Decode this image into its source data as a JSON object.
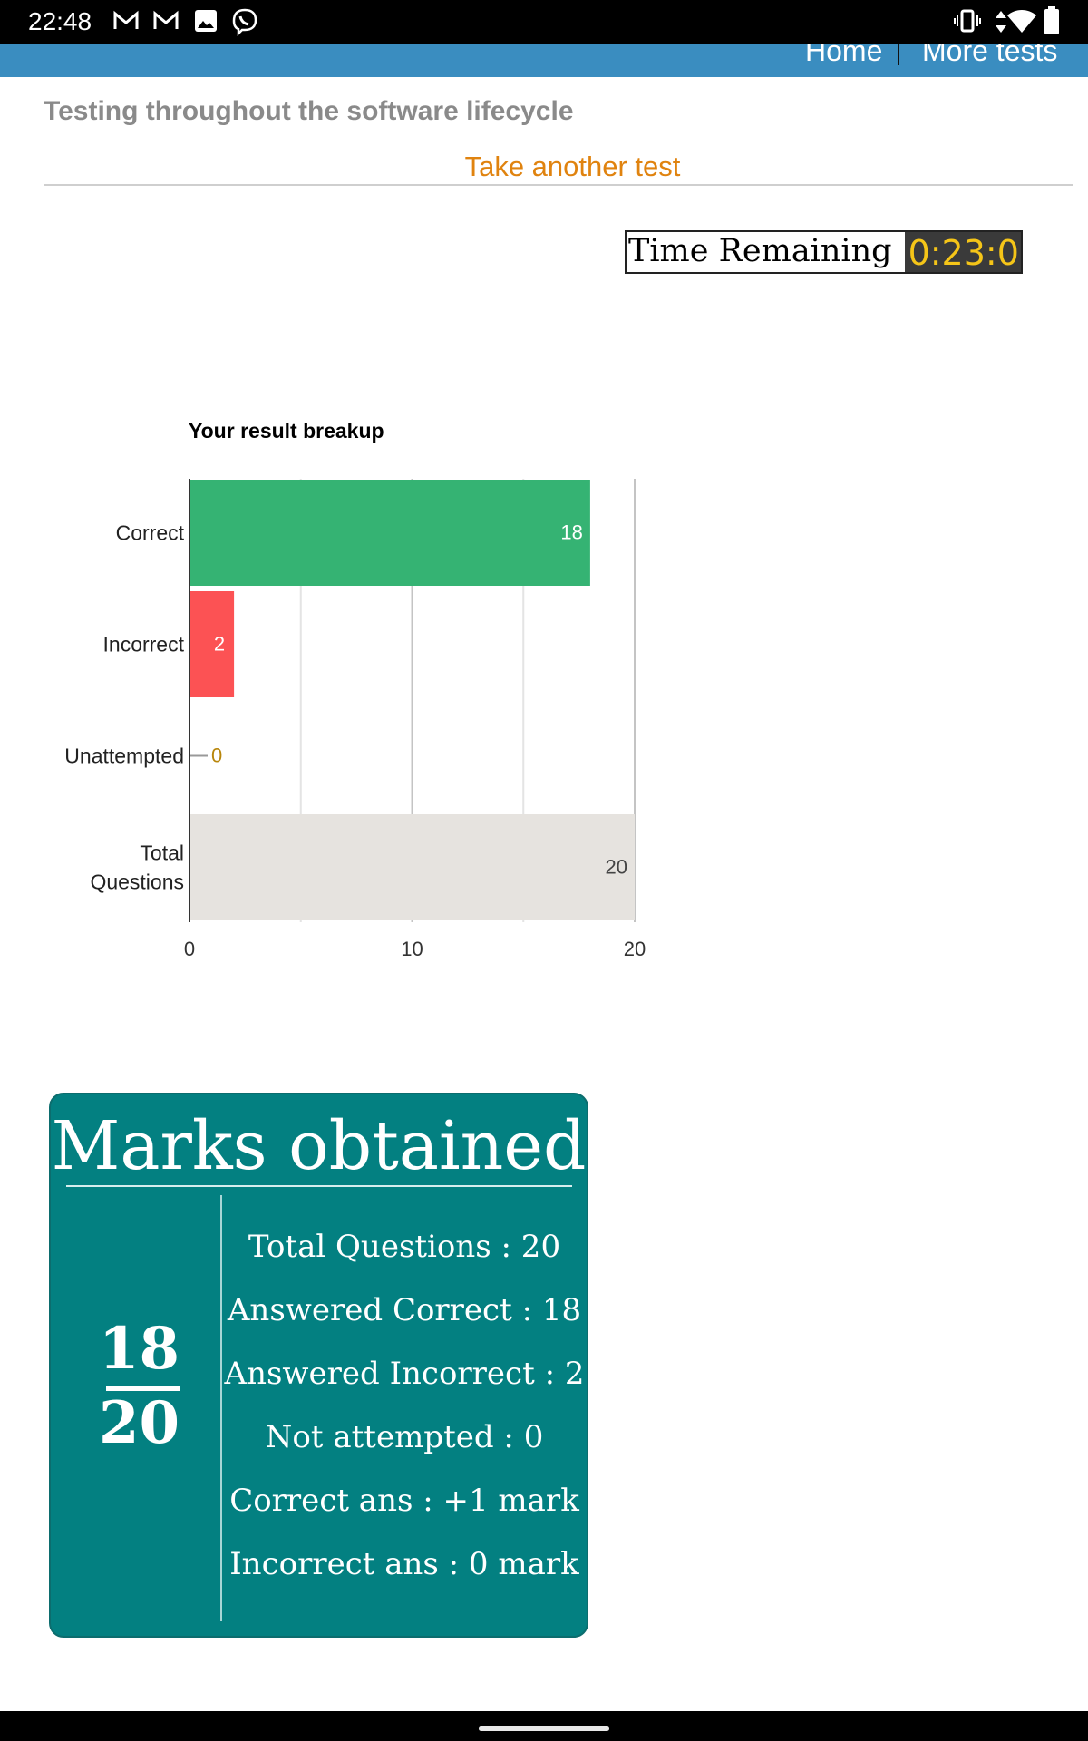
{
  "status_bar": {
    "time": "22:48",
    "icons": [
      "gmail-icon",
      "gmail-icon",
      "image-icon",
      "viber-icon",
      "vibrate-icon",
      "data-arrows-icon",
      "wifi-icon",
      "battery-icon"
    ]
  },
  "nav": {
    "home_label": "Home",
    "more_tests_label": "More tests",
    "bar_color": "#3a8dc0"
  },
  "page": {
    "title": "Testing throughout the software lifecycle",
    "take_another_test": "Take another test"
  },
  "timer": {
    "label": "Time Remaining",
    "value": "0:23:0"
  },
  "chart_data": {
    "type": "bar",
    "orientation": "horizontal",
    "title": "Your result breakup",
    "categories": [
      "Correct",
      "Incorrect",
      "Unattempted",
      "Total Questions"
    ],
    "values": [
      18,
      2,
      0,
      20
    ],
    "colors": [
      "#35b373",
      "#fc5254",
      "#b8860b",
      "#e6e3df"
    ],
    "data_labels": [
      "18",
      "2",
      "0",
      "20"
    ],
    "x_ticks": [
      "0",
      "10",
      "20"
    ],
    "xlim": [
      0,
      20
    ],
    "grid": true,
    "legend": "none"
  },
  "marks": {
    "title": "Marks obtained",
    "score": "18",
    "total": "20",
    "stats": [
      "Total Questions : 20",
      "Answered Correct : 18",
      "Answered Incorrect : 2",
      "Not attempted : 0",
      "Correct ans : +1 mark",
      "Incorrect ans : 0 mark"
    ],
    "card_color": "#038081"
  }
}
